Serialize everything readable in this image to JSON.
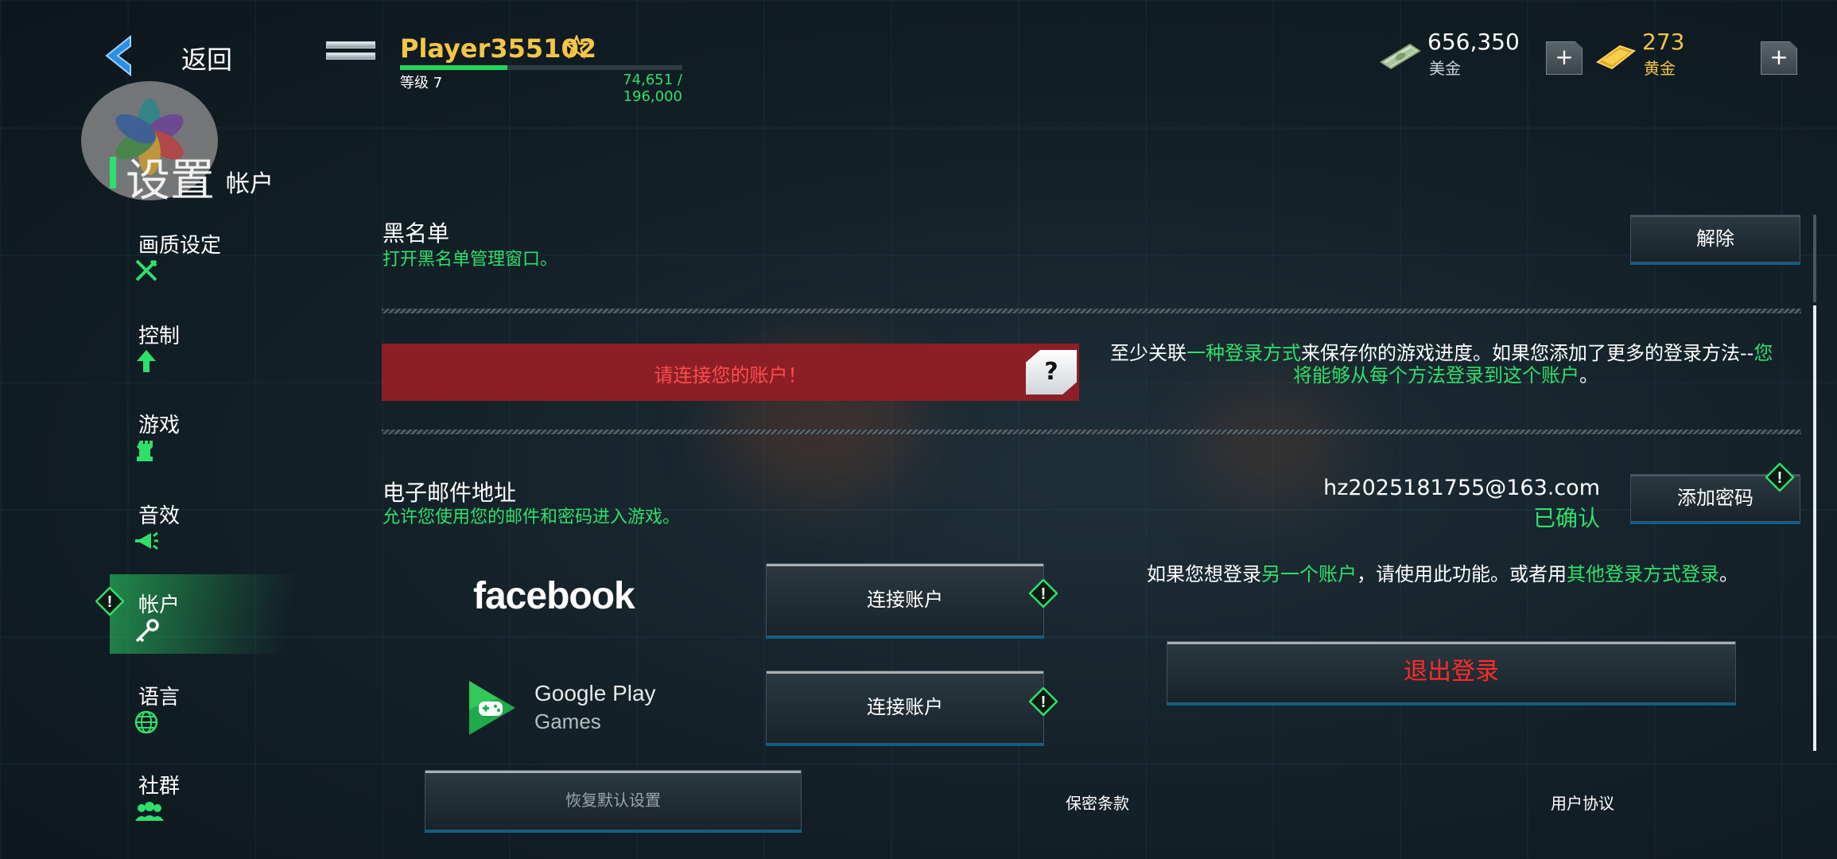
{
  "header": {
    "back_label": "返回",
    "player_name": "Player355102",
    "level_label": "等级 7",
    "xp_text": "74,651 / 196,000",
    "xp_progress": 0.38,
    "cash_value": "656,350",
    "cash_label": "美金",
    "gold_value": "273",
    "gold_label": "黄金",
    "plus": "+"
  },
  "title": {
    "main": "设置",
    "sub": "帐户"
  },
  "sidebar": {
    "items": [
      {
        "label": "画质设定",
        "icon": "wrench-screwdriver-icon"
      },
      {
        "label": "控制",
        "icon": "arrow-up-icon"
      },
      {
        "label": "游戏",
        "icon": "chess-rook-icon"
      },
      {
        "label": "音效",
        "icon": "megaphone-icon"
      },
      {
        "label": "帐户",
        "icon": "key-icon",
        "active": true
      },
      {
        "label": "语言",
        "icon": "globe-icon"
      },
      {
        "label": "社群",
        "icon": "people-icon"
      }
    ],
    "active_warning": "!"
  },
  "blacklist": {
    "title": "黑名单",
    "subtitle": "打开黑名单管理窗口。",
    "button": "解除"
  },
  "connect": {
    "banner": "请连接您的账户！",
    "help": "?",
    "info_1a": "至少关联",
    "info_1b": "一种登录方式",
    "info_1c": "来保存你的游戏进度。如果您添加了更多的登录方法--",
    "info_1d": "您",
    "info_2a": "将能够从每个方法登录到这个账户",
    "info_2b": "。"
  },
  "email": {
    "title": "电子邮件地址",
    "subtitle": "允许您使用您的邮件和密码进入游戏。",
    "address": "hz2025181755@163.com",
    "status": "已确认",
    "button": "添加密码"
  },
  "facebook": {
    "logo": "facebook",
    "button": "连接账户"
  },
  "google": {
    "logo_line1": "Google Play",
    "logo_line2": "Games",
    "button": "连接账户"
  },
  "switch_account": {
    "a": "如果您想登录",
    "b": "另一个账户",
    "c": "，请使用此功能。或者用",
    "d": "其他登录方式登录",
    "e": "。"
  },
  "logout_button": "退出登录",
  "footer": {
    "reset": "恢复默认设置",
    "privacy": "保密条款",
    "terms": "用户协议"
  },
  "colors": {
    "accent": "#2ee06a",
    "gold": "#f3c548",
    "danger": "#ff2b2b",
    "banner": "#8c1f26"
  }
}
